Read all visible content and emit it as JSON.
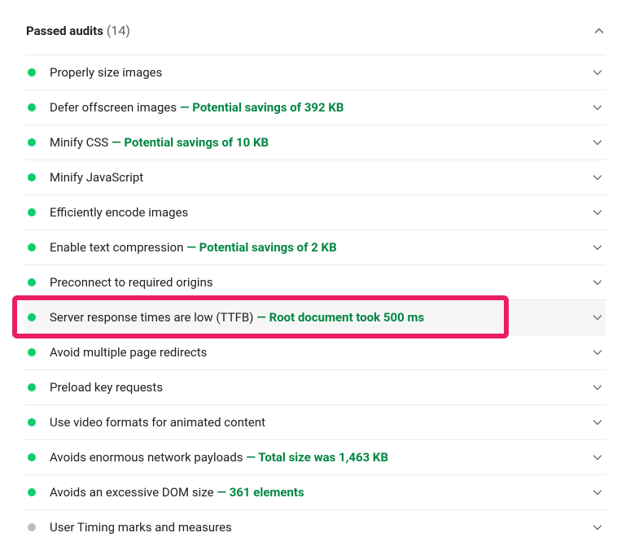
{
  "header": {
    "title": "Passed audits",
    "count": "(14)"
  },
  "audits": [
    {
      "label": "Properly size images",
      "detail": "",
      "dot": "green",
      "hl": false
    },
    {
      "label": "Defer offscreen images",
      "detail": "Potential savings of 392 KB",
      "dot": "green",
      "hl": false
    },
    {
      "label": "Minify CSS",
      "detail": "Potential savings of 10 KB",
      "dot": "green",
      "hl": false
    },
    {
      "label": "Minify JavaScript",
      "detail": "",
      "dot": "green",
      "hl": false
    },
    {
      "label": "Efficiently encode images",
      "detail": "",
      "dot": "green",
      "hl": false
    },
    {
      "label": "Enable text compression",
      "detail": "Potential savings of 2 KB",
      "dot": "green",
      "hl": false
    },
    {
      "label": "Preconnect to required origins",
      "detail": "",
      "dot": "green",
      "hl": false
    },
    {
      "label": "Server response times are low (TTFB)",
      "detail": "Root document took 500 ms",
      "dot": "green",
      "hl": true
    },
    {
      "label": "Avoid multiple page redirects",
      "detail": "",
      "dot": "green",
      "hl": false
    },
    {
      "label": "Preload key requests",
      "detail": "",
      "dot": "green",
      "hl": false
    },
    {
      "label": "Use video formats for animated content",
      "detail": "",
      "dot": "green",
      "hl": false
    },
    {
      "label": "Avoids enormous network payloads",
      "detail": "Total size was 1,463 KB",
      "dot": "green",
      "hl": false
    },
    {
      "label": "Avoids an excessive DOM size",
      "detail": "361 elements",
      "dot": "green",
      "hl": false
    },
    {
      "label": "User Timing marks and measures",
      "detail": "",
      "dot": "gray",
      "hl": false
    }
  ]
}
